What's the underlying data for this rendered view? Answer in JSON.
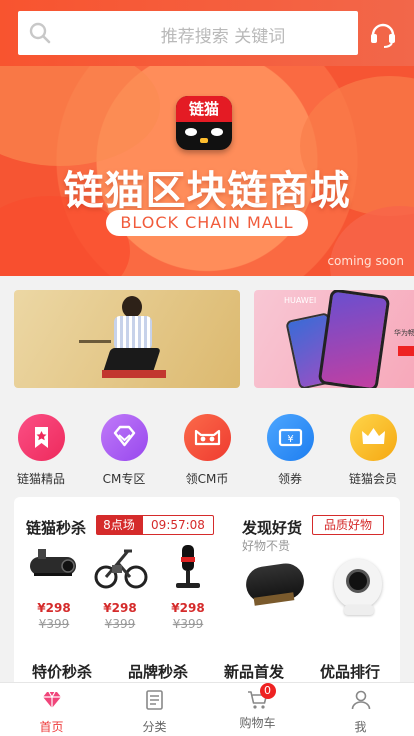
{
  "search": {
    "placeholder": "推荐搜索 关键词"
  },
  "banner": {
    "logo_text": "链猫",
    "title": "链猫区块链商城",
    "subtitle": "BLOCK CHAIN MALL",
    "note": "coming soon"
  },
  "promos": [
    {
      "brand": ""
    },
    {
      "brand": "HUAWEI",
      "caption": "华为畅享"
    }
  ],
  "categories": [
    {
      "label": "链猫精品",
      "icon": "bookmark-star-icon",
      "color": "#f23a6a"
    },
    {
      "label": "CM专区",
      "icon": "gem-icon",
      "color": "#a856f0"
    },
    {
      "label": "领CM币",
      "icon": "cat-coin-icon",
      "color": "#f24a3a"
    },
    {
      "label": "领券",
      "icon": "coupon-icon",
      "color": "#2f8df2"
    },
    {
      "label": "链猫会员",
      "icon": "crown-icon",
      "color": "#f7b51a"
    }
  ],
  "seckill": {
    "title": "链猫秒杀",
    "session": "8点场",
    "countdown": "09:57:08",
    "products": [
      {
        "name": "dashcam",
        "price": "¥298",
        "old_price": "¥399"
      },
      {
        "name": "e-bike",
        "price": "¥298",
        "old_price": "¥399"
      },
      {
        "name": "microphone",
        "price": "¥298",
        "old_price": "¥399"
      }
    ]
  },
  "discover": {
    "title": "发现好货",
    "subtitle": "好物不贵",
    "tag": "品质好物"
  },
  "quick_links": [
    "特价秒杀",
    "品牌秒杀",
    "新品首发",
    "优品排行"
  ],
  "tabs": [
    {
      "label": "首页",
      "icon": "diamond-icon",
      "active": true
    },
    {
      "label": "分类",
      "icon": "list-icon",
      "active": false
    },
    {
      "label": "购物车",
      "icon": "cart-icon",
      "active": false,
      "badge": "0"
    },
    {
      "label": "我",
      "icon": "user-icon",
      "active": false
    }
  ],
  "colors": {
    "brand": "#f65533",
    "accent": "#d52b2b",
    "active_tab": "#ee3b3b"
  }
}
